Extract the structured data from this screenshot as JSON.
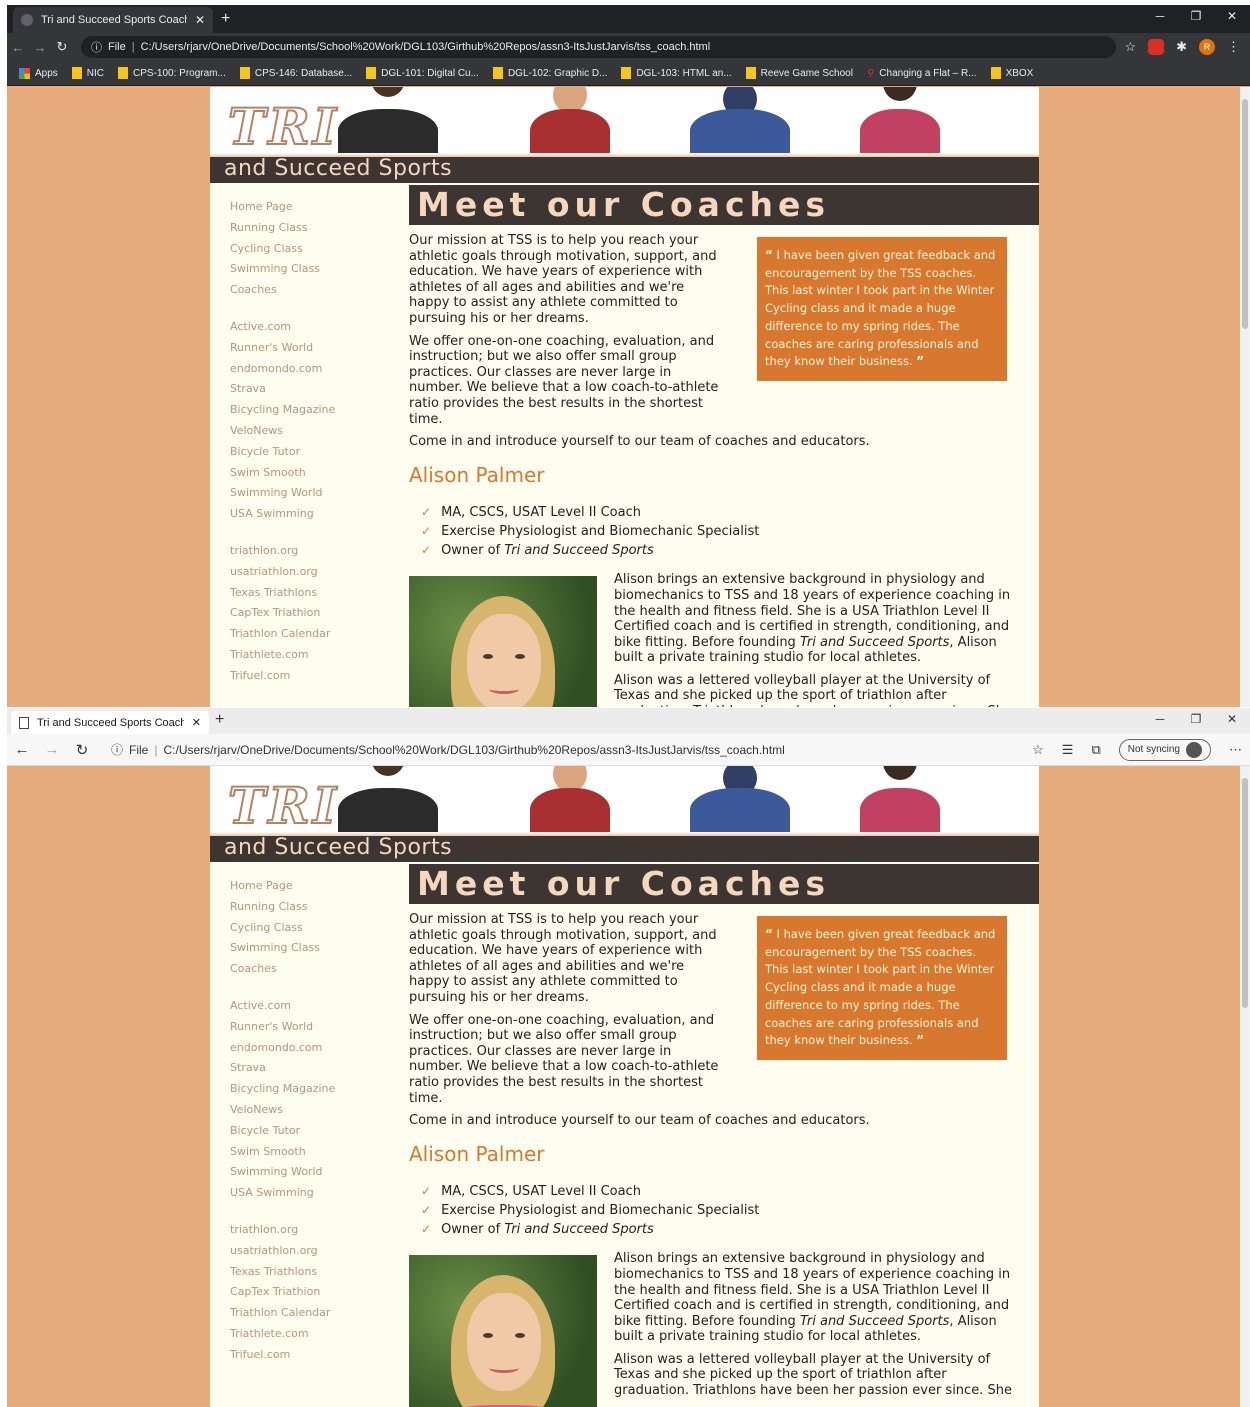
{
  "tab_title": "Tri and Succeed Sports Coaches",
  "url": "C:/Users/rjarv/OneDrive/Documents/School%20Work/DGL103/Girthub%20Repos/assn3-ItsJustJarvis/tss_coach.html",
  "url_scheme_label": "File",
  "chrome": {
    "bookmarks": [
      {
        "label": "Apps",
        "icon": "apps-grid-icon"
      },
      {
        "label": "NIC",
        "icon": "folder-icon"
      },
      {
        "label": "CPS-100: Program...",
        "icon": "folder-icon"
      },
      {
        "label": "CPS-146: Database...",
        "icon": "folder-icon"
      },
      {
        "label": "DGL-101: Digital Cu...",
        "icon": "folder-icon"
      },
      {
        "label": "DGL-102: Graphic D...",
        "icon": "folder-icon"
      },
      {
        "label": "DGL-103: HTML an...",
        "icon": "folder-icon"
      },
      {
        "label": "Reeve Game School",
        "icon": "folder-icon"
      },
      {
        "label": "Changing a Flat – R...",
        "icon": "bike-icon"
      },
      {
        "label": "XBOX",
        "icon": "folder-icon"
      }
    ],
    "profile_initial": "R"
  },
  "edge": {
    "sync_label": "Not syncing"
  },
  "site": {
    "logo_text": "TRI",
    "tagline": "and Succeed Sports",
    "nav_groups": [
      [
        "Home Page",
        "Running Class",
        "Cycling Class",
        "Swimming Class",
        "Coaches"
      ],
      [
        "Active.com",
        "Runner's World",
        "endomondo.com",
        "Strava",
        "Bicycling Magazine",
        "VeloNews",
        "Bicycle Tutor",
        "Swim Smooth",
        "Swimming World",
        "USA Swimming"
      ],
      [
        "triathlon.org",
        "usatriathlon.org",
        "Texas Triathlons",
        "CapTex Triathion",
        "Triathlon Calendar",
        "Triathlete.com",
        "Trifuel.com"
      ]
    ],
    "page_title": "Meet our Coaches",
    "intro_1": "Our mission at TSS is to help you reach your athletic goals through motivation, support, and education. We have years of experience with athletes of all ages and abilities and we're happy to assist any athlete committed to pursuing his or her dreams.",
    "intro_2": "We offer one-on-one coaching, evaluation, and instruction; but we also offer small group practices. Our classes are never large in number. We believe that a low coach-to-athlete ratio provides the best results in the shortest time.",
    "intro_3": "Come in and introduce yourself to our team of coaches and educators.",
    "quote": "I have been given great feedback and encouragement by the TSS coaches. This last winter I took part in the Winter Cycling class and it made a huge difference to my spring rides. The coaches are caring professionals and they know their business.",
    "coach": {
      "name": "Alison Palmer",
      "credentials": [
        "MA, CSCS, USAT Level II Coach",
        "Exercise Physiologist and Biomechanic Specialist"
      ],
      "owner_prefix": "Owner of ",
      "owner_company": "Tri and Succeed Sports",
      "bio_1_a": "Alison brings an extensive background in physiology and biomechanics to TSS and 18 years of experience coaching in the health and fitness field. She is a USA Triathlon Level II Certified coach and is certified in strength, conditioning, and bike fitting. Before founding ",
      "bio_1_company": "Tri and Succeed Sports",
      "bio_1_b": ", Alison built a private training studio for local athletes.",
      "bio_2": "Alison was a lettered volleyball player at the University of Texas and she picked up the sport of triathlon after graduation. Triathlons have been her passion ever since. She"
    }
  }
}
